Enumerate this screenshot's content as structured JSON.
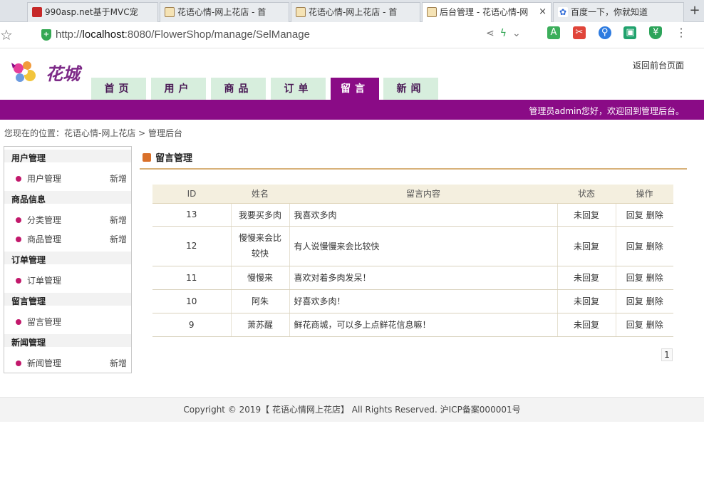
{
  "browser": {
    "tabs": [
      {
        "title": "990asp.net基于MVC宠",
        "icon": "red-logo-icon"
      },
      {
        "title": "花语心情-网上花店 - 首",
        "icon": "flower-page-icon"
      },
      {
        "title": "花语心情-网上花店 - 首",
        "icon": "flower-page-icon"
      },
      {
        "title": "后台管理 - 花语心情-网",
        "icon": "flower-page-icon",
        "close": "×"
      },
      {
        "title": "百度一下，你就知道",
        "icon": "baidu-paw-icon"
      }
    ],
    "new_tab": "+",
    "url_prefix": "http://",
    "url_host": "localhost",
    "url_rest": ":8080/FlowerShop/manage/SelManage"
  },
  "site": {
    "logo_text": "花城",
    "back_link": "返回前台页面",
    "nav": [
      "首页",
      "用户",
      "商品",
      "订单",
      "留言",
      "新闻"
    ],
    "active_nav_index": 4,
    "welcome": "管理员admin您好，欢迎回到管理后台。",
    "breadcrumb": "您现在的位置：花语心情-网上花店 > 管理后台"
  },
  "sidebar": {
    "groups": [
      {
        "title": "用户管理",
        "items": [
          {
            "label": "用户管理",
            "add": "新增"
          }
        ]
      },
      {
        "title": "商品信息",
        "items": [
          {
            "label": "分类管理",
            "add": "新增"
          },
          {
            "label": "商品管理",
            "add": "新增"
          }
        ]
      },
      {
        "title": "订单管理",
        "items": [
          {
            "label": "订单管理",
            "add": ""
          }
        ]
      },
      {
        "title": "留言管理",
        "items": [
          {
            "label": "留言管理",
            "add": ""
          }
        ]
      },
      {
        "title": "新闻管理",
        "items": [
          {
            "label": "新闻管理",
            "add": "新增"
          }
        ]
      }
    ]
  },
  "main": {
    "section_title": "留言管理",
    "table": {
      "headers": [
        "ID",
        "姓名",
        "留言内容",
        "状态",
        "操作"
      ],
      "rows": [
        {
          "id": "13",
          "name": "我要买多肉",
          "content": "我喜欢多肉",
          "status": "未回复",
          "reply": "回复",
          "delete": "删除"
        },
        {
          "id": "12",
          "name": "慢慢来会比较快",
          "content": "有人说慢慢来会比较快",
          "status": "未回复",
          "reply": "回复",
          "delete": "删除"
        },
        {
          "id": "11",
          "name": "慢慢来",
          "content": "喜欢对着多肉发呆！",
          "status": "未回复",
          "reply": "回复",
          "delete": "删除"
        },
        {
          "id": "10",
          "name": "阿朱",
          "content": "好喜欢多肉！",
          "status": "未回复",
          "reply": "回复",
          "delete": "删除"
        },
        {
          "id": "9",
          "name": "萧苏醒",
          "content": "鲜花商城，可以多上点鲜花信息嘛！",
          "status": "未回复",
          "reply": "回复",
          "delete": "删除"
        }
      ]
    },
    "pagination": {
      "current": "1"
    }
  },
  "footer": {
    "text": "Copyright © 2019【 花语心情网上花店】 All Rights Reserved. 沪ICP备案000001号"
  },
  "colors": {
    "brand_purple": "#8a0b86",
    "nav_green": "#d7eedd",
    "table_header_bg": "#f4efdf",
    "section_line": "#d8b27a"
  }
}
